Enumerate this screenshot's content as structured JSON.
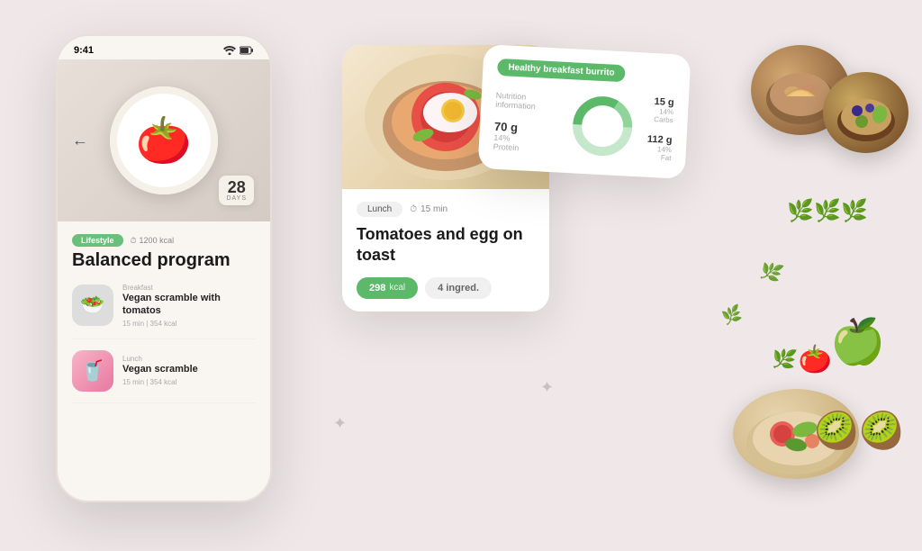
{
  "background_color": "#f0e4e4",
  "phone": {
    "status_time": "9:41",
    "hero_days_num": "28",
    "hero_days_label": "DAYS",
    "back_arrow": "←",
    "meta_tag": "Lifestyle",
    "meta_kcal": "1200 kcal",
    "program_title": "Balanced program",
    "meals": [
      {
        "category": "Breakfast",
        "name": "Vegan scramble with tomatos",
        "time": "15 min",
        "kcal": "354 kcal",
        "emoji": "🥗"
      },
      {
        "category": "Lunch",
        "name": "Vegan scramble",
        "time": "15 min",
        "kcal": "354 kcal",
        "emoji": "🥤"
      }
    ]
  },
  "lunch_card": {
    "tag": "Lunch",
    "time": "15 min",
    "title_line1": "Tomatoes and egg on",
    "title_line2": "toast",
    "kcal": "298",
    "kcal_unit": "kcal",
    "ingredients": "4",
    "ingredients_label": "ingred.",
    "food_emoji": "🍳"
  },
  "nutrition_card": {
    "title": "Healthy breakfast burrito",
    "subtitle": "Nutrition information",
    "protein_value": "70 g",
    "protein_pct": "14%",
    "protein_label": "Protein",
    "carbs_value": "15 g",
    "carbs_pct": "14%",
    "carbs_label": "Carbs",
    "fat_value": "112 g",
    "fat_pct": "14%",
    "fat_label": "Fat",
    "donut_colors": {
      "protein": "#5cb96a",
      "carbs": "#5cb96a",
      "fat": "#5cb96a",
      "bg": "#e8f5e9"
    }
  },
  "sparkles": [
    "✦",
    "✦",
    "✦"
  ],
  "food_items": {
    "bowl1_emoji": "🍗",
    "bowl2_emoji": "🍱",
    "plate_emoji": "🥗",
    "apple_emoji": "🍏",
    "kiwi_emoji": "🥝",
    "leaf_emoji": "🌿",
    "tomato_emoji": "🍅"
  }
}
